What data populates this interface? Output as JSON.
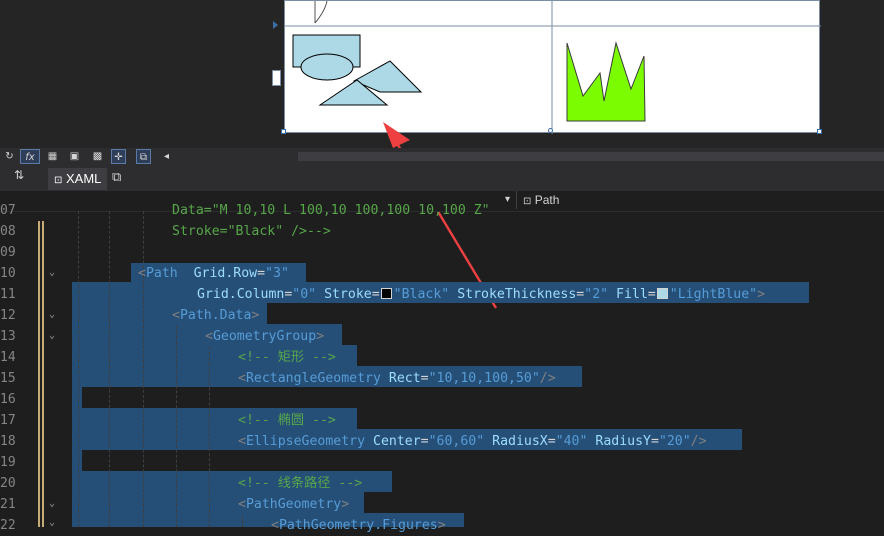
{
  "tab": {
    "label": "XAML"
  },
  "nav": {
    "dropdown_label": "Path"
  },
  "toolbar": {
    "fx_label": "fx"
  },
  "colors": {
    "light_blue": "#add8e6",
    "black": "#000000",
    "grass": "#7cfc00"
  },
  "lines": [
    {
      "n": "07",
      "parts": [
        [
          "cm",
          "Data=\"M 10,10 L 100,10 100,100 10,100 Z\""
        ]
      ]
    },
    {
      "n": "08",
      "parts": [
        [
          "cm",
          "Stroke=\"Black\" />-->"
        ]
      ]
    },
    {
      "n": "09",
      "parts": []
    },
    {
      "n": "10",
      "parts": [
        [
          "br",
          "<"
        ],
        [
          "el",
          "Path"
        ],
        [
          "plain",
          "  "
        ],
        [
          "attr",
          "Grid.Row"
        ],
        [
          "eq",
          "="
        ],
        [
          "val",
          "\"3\""
        ]
      ]
    },
    {
      "n": "11",
      "parts": [
        [
          "attr",
          "Grid.Column"
        ],
        [
          "eq",
          "="
        ],
        [
          "val",
          "\"0\""
        ],
        [
          "plain",
          " "
        ],
        [
          "attr",
          "Stroke"
        ],
        [
          "eq",
          "="
        ],
        [
          "sw",
          "#000000"
        ],
        [
          "val",
          "\"Black\""
        ],
        [
          "plain",
          " "
        ],
        [
          "attr",
          "StrokeThickness"
        ],
        [
          "eq",
          "="
        ],
        [
          "val",
          "\"2\""
        ],
        [
          "plain",
          " "
        ],
        [
          "attr",
          "Fill"
        ],
        [
          "eq",
          "="
        ],
        [
          "sw",
          "#add8e6"
        ],
        [
          "val",
          "\"LightBlue\""
        ],
        [
          "br",
          ">"
        ]
      ]
    },
    {
      "n": "12",
      "parts": [
        [
          "br",
          "<"
        ],
        [
          "el",
          "Path.Data"
        ],
        [
          "br",
          ">"
        ]
      ]
    },
    {
      "n": "13",
      "parts": [
        [
          "br",
          "<"
        ],
        [
          "el",
          "GeometryGroup"
        ],
        [
          "br",
          ">"
        ]
      ]
    },
    {
      "n": "14",
      "parts": [
        [
          "cm",
          "<!-- 矩形 -->"
        ]
      ]
    },
    {
      "n": "15",
      "parts": [
        [
          "br",
          "<"
        ],
        [
          "el",
          "RectangleGeometry"
        ],
        [
          "plain",
          " "
        ],
        [
          "attr",
          "Rect"
        ],
        [
          "eq",
          "="
        ],
        [
          "val",
          "\"10,10,100,50\""
        ],
        [
          "br",
          "/>"
        ]
      ]
    },
    {
      "n": "16",
      "parts": []
    },
    {
      "n": "17",
      "parts": [
        [
          "cm",
          "<!-- 椭圆 -->"
        ]
      ]
    },
    {
      "n": "18",
      "parts": [
        [
          "br",
          "<"
        ],
        [
          "el",
          "EllipseGeometry"
        ],
        [
          "plain",
          " "
        ],
        [
          "attr",
          "Center"
        ],
        [
          "eq",
          "="
        ],
        [
          "val",
          "\"60,60\""
        ],
        [
          "plain",
          " "
        ],
        [
          "attr",
          "RadiusX"
        ],
        [
          "eq",
          "="
        ],
        [
          "val",
          "\"40\""
        ],
        [
          "plain",
          " "
        ],
        [
          "attr",
          "RadiusY"
        ],
        [
          "eq",
          "="
        ],
        [
          "val",
          "\"20\""
        ],
        [
          "br",
          "/>"
        ]
      ]
    },
    {
      "n": "19",
      "parts": []
    },
    {
      "n": "20",
      "parts": [
        [
          "cm",
          "<!-- 线条路径 -->"
        ]
      ]
    },
    {
      "n": "21",
      "parts": [
        [
          "br",
          "<"
        ],
        [
          "el",
          "PathGeometry"
        ],
        [
          "br",
          ">"
        ]
      ]
    },
    {
      "n": "22",
      "parts": [
        [
          "br",
          "<"
        ],
        [
          "el",
          "PathGeometry.Figures"
        ],
        [
          "br",
          ">"
        ]
      ]
    }
  ]
}
